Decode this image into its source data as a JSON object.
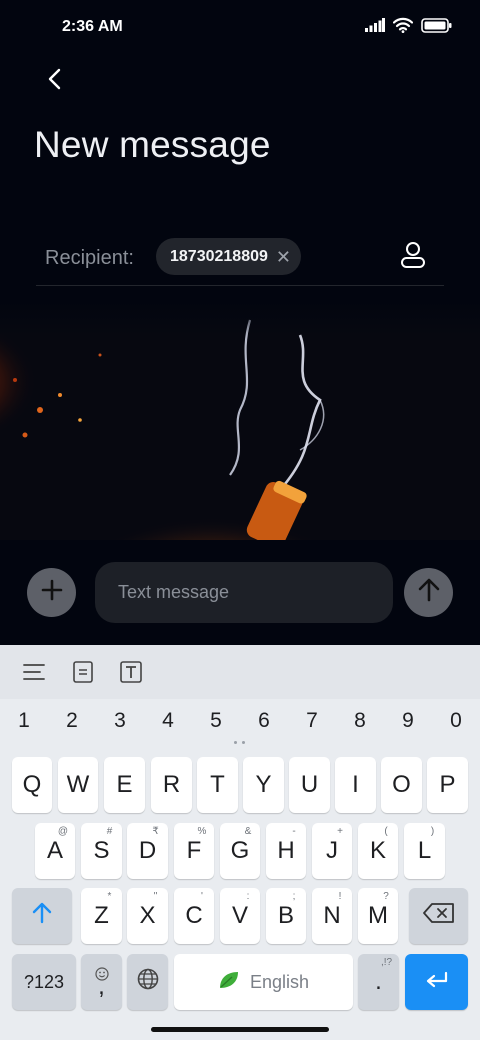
{
  "status_bar": {
    "time": "2:36 AM"
  },
  "header": {
    "title": "New message"
  },
  "recipient": {
    "label": "Recipient:",
    "chip": "18730218809"
  },
  "compose": {
    "placeholder": "Text message"
  },
  "keyboard": {
    "numbers": [
      "1",
      "2",
      "3",
      "4",
      "5",
      "6",
      "7",
      "8",
      "9",
      "0"
    ],
    "row1": [
      "Q",
      "W",
      "E",
      "R",
      "T",
      "Y",
      "U",
      "I",
      "O",
      "P"
    ],
    "row2": [
      "A",
      "S",
      "D",
      "F",
      "G",
      "H",
      "J",
      "K",
      "L"
    ],
    "row2_hints": [
      "@",
      "#",
      "₹",
      "%",
      "&",
      "-",
      "+",
      "(",
      ")"
    ],
    "row3": [
      "Z",
      "X",
      "C",
      "V",
      "B",
      "N",
      "M"
    ],
    "row3_hints": [
      "*",
      "\"",
      "'",
      ":",
      ";",
      "!",
      "?"
    ],
    "symbols_label": "?123",
    "comma": ",",
    "space_label": "English",
    "period": ".",
    "period_hint": ",!?"
  },
  "colors": {
    "accent": "#1a8ff5",
    "background": "#02050f"
  }
}
